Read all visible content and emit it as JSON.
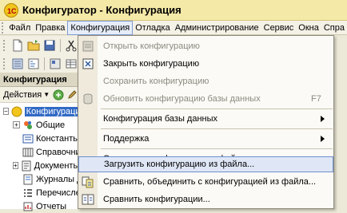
{
  "window": {
    "title": "Конфигуратор - Конфигурация"
  },
  "menubar": {
    "items": [
      {
        "label": "Файл",
        "active": false
      },
      {
        "label": "Правка",
        "active": false
      },
      {
        "label": "Конфигурация",
        "active": true
      },
      {
        "label": "Отладка",
        "active": false
      },
      {
        "label": "Администрирование",
        "active": false
      },
      {
        "label": "Сервис",
        "active": false
      },
      {
        "label": "Окна",
        "active": false
      },
      {
        "label": "Спра",
        "active": false
      }
    ]
  },
  "panel": {
    "title": "Конфигурация",
    "actions_label": "Действия",
    "tree": [
      {
        "label": "Конфигурация",
        "selected": true,
        "icon": "circle-icon"
      },
      {
        "label": "Общие",
        "selected": false,
        "icon": "common-icon"
      },
      {
        "label": "Константы",
        "selected": false,
        "icon": "constants-icon"
      },
      {
        "label": "Справочник",
        "selected": false,
        "icon": "catalog-icon"
      },
      {
        "label": "Документы",
        "selected": false,
        "icon": "documents-icon"
      },
      {
        "label": "Журналы до",
        "selected": false,
        "icon": "journals-icon"
      },
      {
        "label": "Перечислен",
        "selected": false,
        "icon": "enums-icon"
      },
      {
        "label": "Отчеты",
        "selected": false,
        "icon": "reports-icon"
      }
    ]
  },
  "dropdown": {
    "items": [
      {
        "label": "Открыть конфигурацию",
        "disabled": true,
        "icon": "open-config-icon"
      },
      {
        "label": "Закрыть конфигурацию",
        "disabled": false,
        "icon": "close-config-icon"
      },
      {
        "label": "Сохранить конфигурацию",
        "disabled": true,
        "icon": ""
      },
      {
        "label": "Обновить конфигурацию базы данных",
        "disabled": true,
        "icon": "db-update-icon",
        "shortcut": "F7"
      },
      {
        "label": "Конфигурация базы данных",
        "disabled": false,
        "icon": "",
        "submenu": true
      },
      {
        "label": "Поддержка",
        "disabled": false,
        "icon": "",
        "submenu": true
      },
      {
        "label": "Сохранить конфигурацию в файл...",
        "disabled": false,
        "icon": ""
      },
      {
        "label": "Загрузить конфигурацию из файла...",
        "disabled": false,
        "icon": "",
        "hover": true
      },
      {
        "label": "Сравнить, объединить с конфигурацией из файла...",
        "disabled": false,
        "icon": "compare-merge-icon"
      },
      {
        "label": "Сравнить конфигурации...",
        "disabled": false,
        "icon": "compare-icon"
      }
    ]
  },
  "colors": {
    "selection": "#316ac5",
    "hover_border": "#6e8ecf",
    "disabled_text": "#8d8a7f"
  }
}
